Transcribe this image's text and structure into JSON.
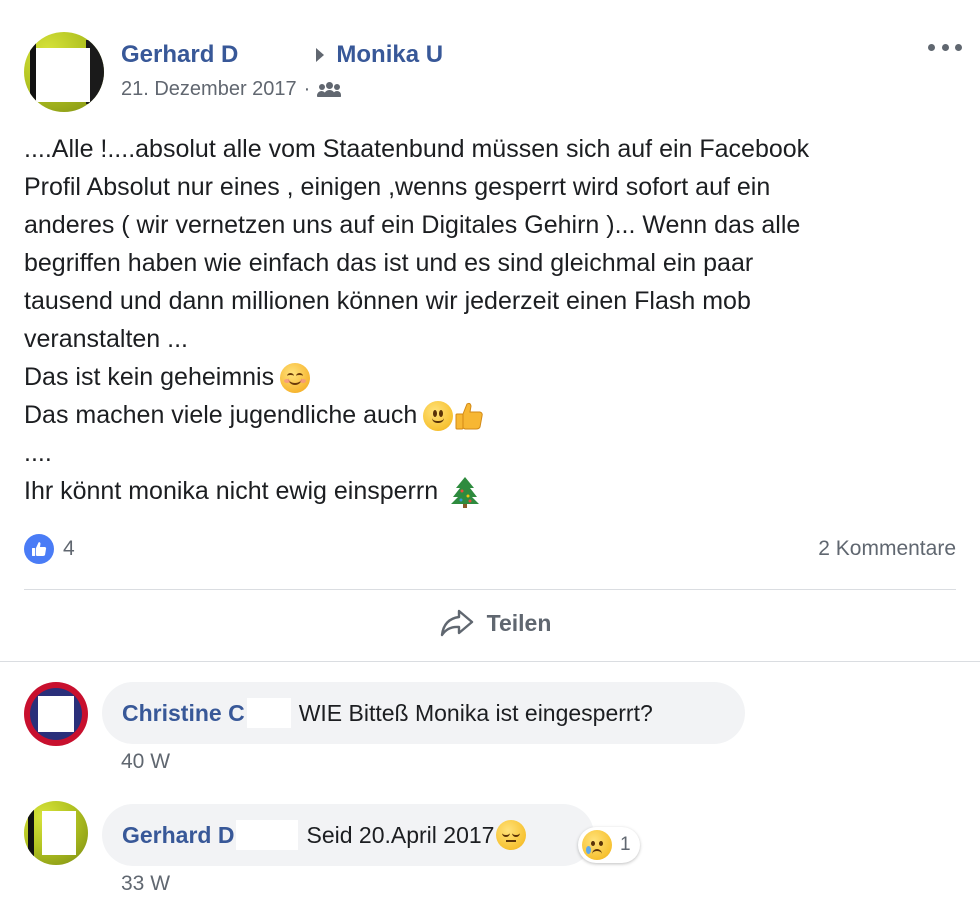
{
  "post": {
    "author": "Gerhard D",
    "target": "Monika U",
    "date": "21. Dezember 2017",
    "separator": "·",
    "audience_icon": "friends-icon",
    "more_icon": "more-options-icon",
    "text_lines": [
      "....Alle !....absolut alle vom Staatenbund müssen sich auf ein Facebook",
      "Profil Absolut nur eines , einigen ,wenns gesperrt wird sofort auf ein",
      "anderes ( wir vernetzen uns auf ein Digitales Gehirn )... Wenn das alle",
      "begriffen haben wie einfach das ist und es sind gleichmal ein paar",
      "tausend und dann millionen können wir jederzeit einen Flash mob",
      "veranstalten ...",
      "Das ist kein geheimnis",
      "Das machen viele jugendliche auch",
      "....",
      "Ihr könnt monika nicht ewig einsperrn"
    ],
    "like_count": "4",
    "comments_label": "2 Kommentare",
    "share_label": "Teilen"
  },
  "comments": [
    {
      "author": "Christine C",
      "text": "WIE Bitteß Monika ist eingesperrt?",
      "time": "40 W"
    },
    {
      "author": "Gerhard D",
      "text": "Seid 20.April 2017",
      "time": "33 W",
      "reaction_count": "1"
    }
  ],
  "colors": {
    "link": "#385898",
    "meta": "#616770",
    "like_blue": "#4a7cf6",
    "bubble": "#f2f3f5"
  }
}
